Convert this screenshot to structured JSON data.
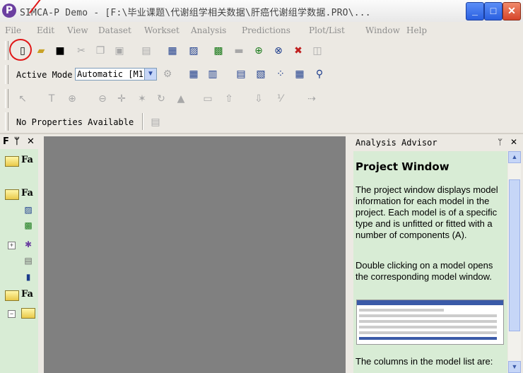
{
  "window": {
    "app_icon": "P",
    "title": "SIMCA-P Demo - [F:\\毕业课题\\代谢组学相关数据\\肝癌代谢组学数据.PRO\\...",
    "min": "_",
    "max": "□",
    "close": "✕"
  },
  "menu": [
    "File",
    "Edit",
    "View",
    "Dataset",
    "Workset",
    "Analysis",
    "Predictions",
    "Plot/List",
    "Window",
    "Help"
  ],
  "toolbar2": {
    "active_mode_label": "Active Mode",
    "mode_value": "Automatic [M1"
  },
  "toolbar4": {
    "properties_label": "No Properties Available"
  },
  "left_panel": {
    "title": "F",
    "pin": "ᛘ",
    "close": "✕",
    "fav": "Fa"
  },
  "advisor": {
    "title": "Analysis Advisor",
    "pin": "ᛘ",
    "close": "✕",
    "heading": "Project Window",
    "p1": "The project window displays model information for each model in the project. Each model is of a specific type and is unfitted or fitted with a number of components (A).",
    "p2": "Double clicking on a model opens the corresponding model window.",
    "p3": "The columns in the model list are:"
  }
}
